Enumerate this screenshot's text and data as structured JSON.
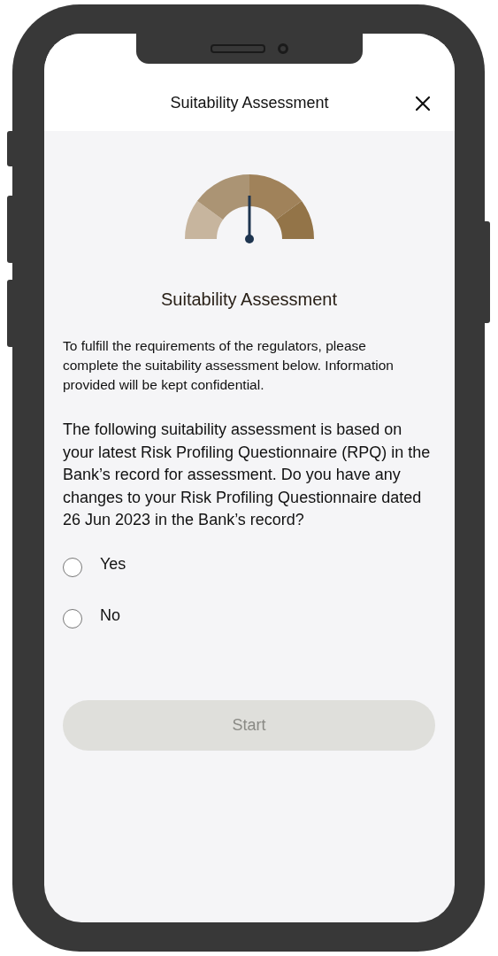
{
  "header": {
    "title": "Suitability Assessment"
  },
  "heading": "Suitability Assessment",
  "intro": "To fulfill the requirements of the regulators, please complete the suitability assessment below. Information provided will be kept confidential.",
  "question": "The following suitability assessment is based on your latest Risk Profiling Questionnaire (RPQ) in the Bank’s record for assessment. Do you have any changes to your Risk Profiling Questionnaire dated 26 Jun 2023 in the Bank’s record?",
  "options": [
    {
      "label": "Yes",
      "selected": false
    },
    {
      "label": "No",
      "selected": false
    }
  ],
  "start_button": {
    "label": "Start",
    "disabled": true
  }
}
